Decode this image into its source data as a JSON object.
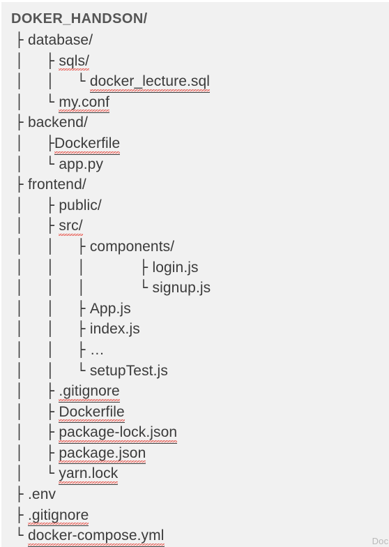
{
  "canvas": {
    "background_color": "#f1f1f1",
    "text_color": "#3b3b3b",
    "title_color": "#555555",
    "spellcheck_color": "#e8453c",
    "watermark_color": "#b9b9b9"
  },
  "tree": {
    "root_label": "DOKER_HANDSON/",
    "rows": [
      {
        "guides": "   ├ ",
        "label": "database/",
        "spell": false,
        "underline": false
      },
      {
        "guides": "   │     ├ ",
        "label": "sqls/",
        "spell": true,
        "underline": false
      },
      {
        "guides": "   │     │     └ ",
        "label": "docker_lecture.sql",
        "spell": true,
        "underline": true
      },
      {
        "guides": "   │     └ ",
        "label": "my.conf",
        "spell": true,
        "underline": true
      },
      {
        "guides": "   ├ ",
        "label": "backend/",
        "spell": false,
        "underline": false
      },
      {
        "guides": "   │     ├",
        "label": "Dockerfile",
        "spell": true,
        "underline": true
      },
      {
        "guides": "   │     └ ",
        "label": "app.py",
        "spell": false,
        "underline": false
      },
      {
        "guides": "   ├ ",
        "label": "frontend/",
        "spell": false,
        "underline": false
      },
      {
        "guides": "   │     ├ ",
        "label": "public/",
        "spell": false,
        "underline": false
      },
      {
        "guides": "   │     ├ ",
        "label": "src/",
        "spell": true,
        "underline": false
      },
      {
        "guides": "   │     │     ├ ",
        "label": "components/",
        "spell": false,
        "underline": false
      },
      {
        "guides": "   │     │     │            ├ ",
        "label": "login.js",
        "spell": false,
        "underline": false
      },
      {
        "guides": "   │     │     │            └ ",
        "label": "signup.js",
        "spell": false,
        "underline": false
      },
      {
        "guides": "   │     │     ├ ",
        "label": "App.js",
        "spell": false,
        "underline": false
      },
      {
        "guides": "   │     │     ├ ",
        "label": "index.js",
        "spell": false,
        "underline": false
      },
      {
        "guides": "   │     │     ├ ",
        "label": "…",
        "spell": false,
        "underline": false
      },
      {
        "guides": "   │     │     └ ",
        "label": "setupTest.js",
        "spell": false,
        "underline": false
      },
      {
        "guides": "   │     ├ ",
        "label": ".gitignore",
        "spell": true,
        "underline": true
      },
      {
        "guides": "   │     ├ ",
        "label": "Dockerfile",
        "spell": true,
        "underline": true
      },
      {
        "guides": "   │     ├ ",
        "label": "package-lock.json",
        "spell": true,
        "underline": true
      },
      {
        "guides": "   │     ├ ",
        "label": "package.json",
        "spell": true,
        "underline": true
      },
      {
        "guides": "   │     └ ",
        "label": "yarn.lock",
        "spell": true,
        "underline": true
      },
      {
        "guides": "   ├ ",
        "label": ".env",
        "spell": false,
        "underline": false
      },
      {
        "guides": "   ├ ",
        "label": ".gitignore",
        "spell": true,
        "underline": true
      },
      {
        "guides": "   └ ",
        "label": "docker-compose.yml",
        "spell": true,
        "underline": true
      }
    ]
  },
  "watermark": {
    "text": "Dock"
  }
}
